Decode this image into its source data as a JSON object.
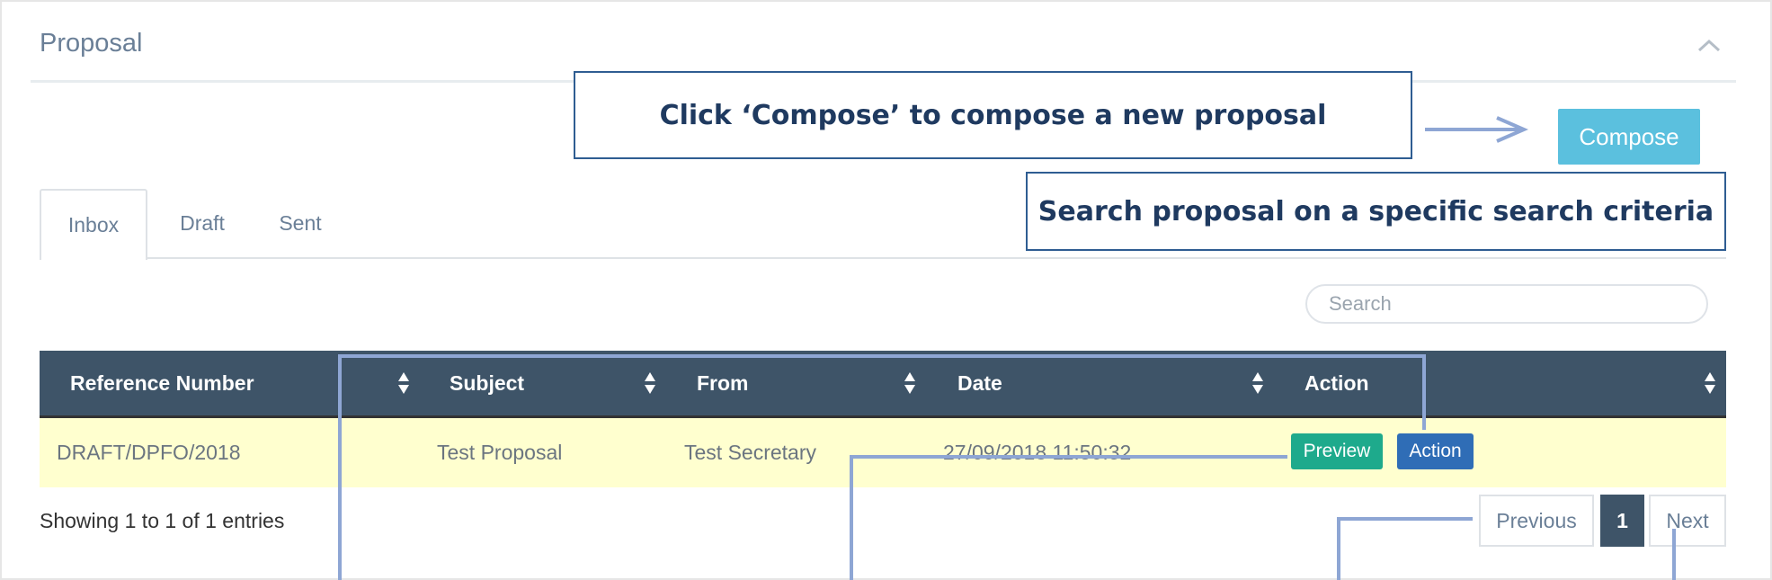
{
  "panel": {
    "title": "Proposal"
  },
  "callouts": {
    "compose": "Click  ‘Compose’ to compose a  new proposal",
    "search": "Search proposal on a specific search criteria"
  },
  "toolbar": {
    "compose_label": "Compose"
  },
  "tabs": [
    {
      "label": "Inbox",
      "active": true
    },
    {
      "label": "Draft"
    },
    {
      "label": "Sent"
    }
  ],
  "search": {
    "placeholder": "Search"
  },
  "table": {
    "columns": [
      "Reference Number",
      "Subject",
      "From",
      "Date",
      "Action"
    ],
    "rows": [
      {
        "reference": "DRAFT/DPFO/2018",
        "subject": "Test Proposal",
        "from": "Test Secretary",
        "date": "27/09/2018 11:50:32",
        "preview_label": "Preview",
        "action_label": "Action"
      }
    ]
  },
  "footer": {
    "showing": "Showing 1 to 1 of 1 entries"
  },
  "pagination": {
    "previous": "Previous",
    "current": "1",
    "next": "Next"
  },
  "colors": {
    "header_bg": "#3e5468",
    "row_highlight": "#ffffcf",
    "compose_btn": "#5bc0de",
    "preview_btn": "#1eaa8c",
    "action_btn": "#2f6db6",
    "annotation_line": "#8ea6d4"
  },
  "icons": [
    "chevron-up-icon",
    "sort-icon",
    "arrow-right-icon"
  ]
}
